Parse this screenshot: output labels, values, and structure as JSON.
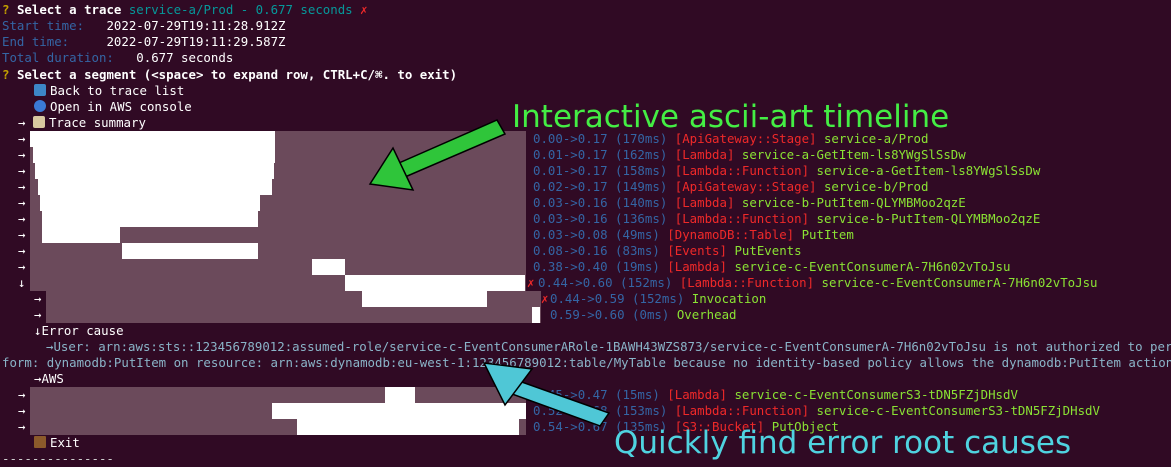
{
  "header": {
    "q1_mark": "?",
    "select_trace_label": "Select a trace",
    "selected_trace": "service-a/Prod - 0.677 seconds",
    "error_mark": "✗",
    "start_label": "Start time:",
    "start_value": "2022-07-29T19:11:28.912Z",
    "end_label": "End time:",
    "end_value": "2022-07-29T19:11:29.587Z",
    "duration_label": "Total duration:",
    "duration_value": "0.677 seconds",
    "q2_mark": "?",
    "select_segment_prompt": "Select a segment (<space> to expand row, CTRL+C/⌘. to exit)"
  },
  "menu": {
    "back": "Back to trace list",
    "open_console": "Open in AWS console",
    "summary": "Trace summary"
  },
  "arrows": {
    "right": "→",
    "down": "↓"
  },
  "segments": [
    {
      "timing": "0.00->0.17 (170ms)",
      "type": "[ApiGateway::Stage]",
      "name": "service-a/Prod",
      "err": false
    },
    {
      "timing": "0.01->0.17 (162ms)",
      "type": "[Lambda]",
      "name": "service-a-GetItem-ls8YWgSlSsDw",
      "err": false
    },
    {
      "timing": "0.01->0.17 (158ms)",
      "type": "[Lambda::Function]",
      "name": "service-a-GetItem-ls8YWgSlSsDw",
      "err": false
    },
    {
      "timing": "0.02->0.17 (149ms)",
      "type": "[ApiGateway::Stage]",
      "name": "service-b/Prod",
      "err": false
    },
    {
      "timing": "0.03->0.16 (140ms)",
      "type": "[Lambda]",
      "name": "service-b-PutItem-QLYMBMoo2qzE",
      "err": false
    },
    {
      "timing": "0.03->0.16 (136ms)",
      "type": "[Lambda::Function]",
      "name": "service-b-PutItem-QLYMBMoo2qzE",
      "err": false
    },
    {
      "timing": "0.03->0.08 (49ms)",
      "type": "[DynamoDB::Table]",
      "name": "PutItem",
      "err": false
    },
    {
      "timing": "0.08->0.16 (83ms)",
      "type": "[Events]",
      "name": "PutEvents",
      "err": false
    },
    {
      "timing": "0.38->0.40 (19ms)",
      "type": "[Lambda]",
      "name": "service-c-EventConsumerA-7H6n02vToJsu",
      "err": false
    },
    {
      "timing": "0.44->0.60 (152ms)",
      "type": "[Lambda::Function]",
      "name": "service-c-EventConsumerA-7H6n02vToJsu",
      "err": true
    },
    {
      "timing": "0.44->0.59 (152ms)",
      "type": "",
      "name": "Invocation",
      "err": true
    },
    {
      "timing": "0.59->0.60 (0ms)",
      "type": "",
      "name": "Overhead",
      "err": false
    }
  ],
  "error_cause": {
    "label": "Error cause",
    "line1": "→User: arn:aws:sts::123456789012:assumed-role/service-c-EventConsumerARole-1BAWH43WZS873/service-c-EventConsumerA-7H6n02vToJsu is not authorized to per",
    "line2": "form: dynamodb:PutItem on resource: arn:aws:dynamodb:eu-west-1:123456789012:table/MyTable because no identity-based policy allows the dynamodb:PutItem action",
    "aws_label": "→AWS"
  },
  "segments2": [
    {
      "timing": "0.45->0.47 (15ms)",
      "type": "[Lambda]",
      "name": "service-c-EventConsumerS3-tDN5FZjDHsdV"
    },
    {
      "timing": "0.52->0.68 (153ms)",
      "type": "[Lambda::Function]",
      "name": "service-c-EventConsumerS3-tDN5FZjDHsdV"
    },
    {
      "timing": "0.54->0.67 (135ms)",
      "type": "[S3::Bucket]",
      "name": "PutObject"
    }
  ],
  "exit_label": "Exit",
  "footer_rule": "---------------",
  "annotations": {
    "timeline": "Interactive ascii-art timeline",
    "errors": "Quickly find error root causes",
    "timeline_color": "#44ee44",
    "errors_color": "#4fd3e0"
  }
}
